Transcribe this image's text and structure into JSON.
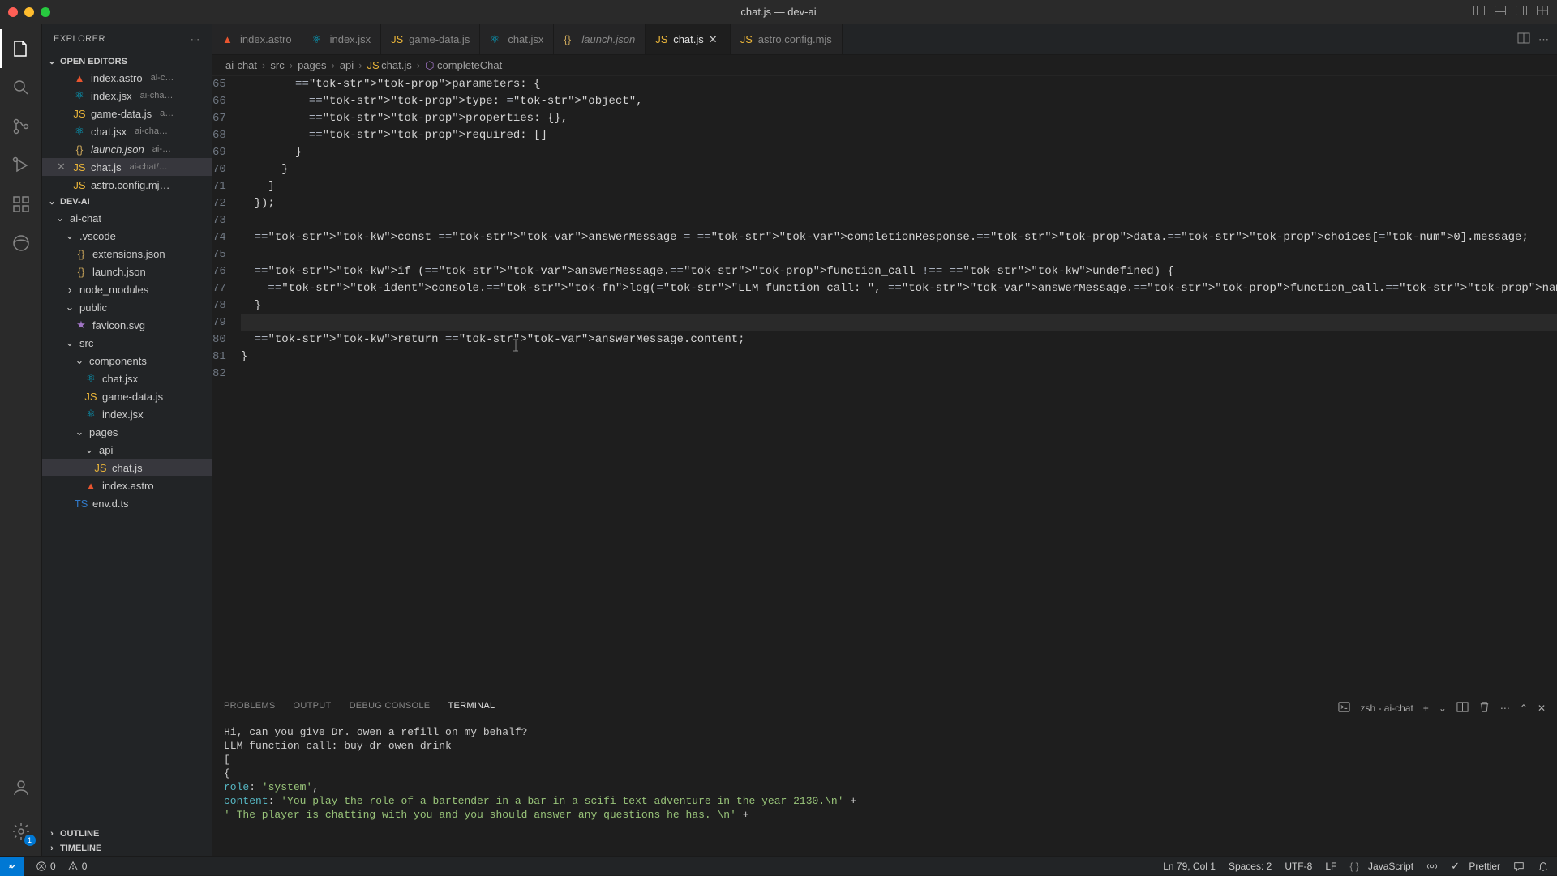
{
  "window": {
    "title": "chat.js — dev-ai"
  },
  "sidebar": {
    "title": "EXPLORER",
    "openEditorsLabel": "OPEN EDITORS",
    "openEditors": [
      {
        "name": "index.astro",
        "desc": "ai-c…",
        "kind": "astro"
      },
      {
        "name": "index.jsx",
        "desc": "ai-cha…",
        "kind": "jsx"
      },
      {
        "name": "game-data.js",
        "desc": "a…",
        "kind": "js"
      },
      {
        "name": "chat.jsx",
        "desc": "ai-cha…",
        "kind": "jsx"
      },
      {
        "name": "launch.json",
        "desc": "ai-…",
        "kind": "json",
        "italic": true
      },
      {
        "name": "chat.js",
        "desc": "ai-chat/…",
        "kind": "js",
        "active": true
      },
      {
        "name": "astro.config.mj…",
        "desc": "",
        "kind": "js"
      }
    ],
    "projectLabel": "DEV-AI",
    "tree": [
      {
        "label": "ai-chat",
        "indent": 1,
        "kind": "chev",
        "open": true
      },
      {
        "label": ".vscode",
        "indent": 2,
        "kind": "chev",
        "open": true
      },
      {
        "label": "extensions.json",
        "indent": 3,
        "kind": "json"
      },
      {
        "label": "launch.json",
        "indent": 3,
        "kind": "json"
      },
      {
        "label": "node_modules",
        "indent": 2,
        "kind": "chev",
        "open": false
      },
      {
        "label": "public",
        "indent": 2,
        "kind": "chev",
        "open": true
      },
      {
        "label": "favicon.svg",
        "indent": 3,
        "kind": "svg"
      },
      {
        "label": "src",
        "indent": 2,
        "kind": "chev",
        "open": true
      },
      {
        "label": "components",
        "indent": 3,
        "kind": "chev",
        "open": true
      },
      {
        "label": "chat.jsx",
        "indent": 4,
        "kind": "jsx"
      },
      {
        "label": "game-data.js",
        "indent": 4,
        "kind": "js"
      },
      {
        "label": "index.jsx",
        "indent": 4,
        "kind": "jsx"
      },
      {
        "label": "pages",
        "indent": 3,
        "kind": "chev",
        "open": true
      },
      {
        "label": "api",
        "indent": 4,
        "kind": "chev",
        "open": true
      },
      {
        "label": "chat.js",
        "indent": 5,
        "kind": "js",
        "selected": true
      },
      {
        "label": "index.astro",
        "indent": 4,
        "kind": "astro"
      },
      {
        "label": "env.d.ts",
        "indent": 3,
        "kind": "ts"
      }
    ],
    "outlineLabel": "OUTLINE",
    "timelineLabel": "TIMELINE"
  },
  "tabs": [
    {
      "label": "index.astro",
      "kind": "astro"
    },
    {
      "label": "index.jsx",
      "kind": "jsx"
    },
    {
      "label": "game-data.js",
      "kind": "js"
    },
    {
      "label": "chat.jsx",
      "kind": "jsx"
    },
    {
      "label": "launch.json",
      "kind": "json",
      "italic": true
    },
    {
      "label": "chat.js",
      "kind": "js",
      "active": true
    },
    {
      "label": "astro.config.mjs",
      "kind": "js"
    }
  ],
  "breadcrumbs": [
    "ai-chat",
    "src",
    "pages",
    "api",
    "chat.js",
    "completeChat"
  ],
  "code": {
    "start": 65,
    "lines": [
      "        parameters: {",
      "          type: \"object\",",
      "          properties: {},",
      "          required: []",
      "        }",
      "      }",
      "    ]",
      "  });",
      "",
      "  const answerMessage = completionResponse.data.choices[0].message;",
      "",
      "  if (answerMessage.function_call !== undefined) {",
      "    console.log(\"LLM function call: \", answerMessage.function_call.name);",
      "  }",
      "",
      "  return answerMessage.content;",
      "}",
      ""
    ]
  },
  "panel": {
    "tabs": {
      "problems": "PROBLEMS",
      "output": "OUTPUT",
      "debug": "DEBUG CONSOLE",
      "terminal": "TERMINAL"
    },
    "shell": "zsh - ai-chat",
    "output": [
      "Hi, can you give Dr. owen a refill on my behalf?",
      "LLM function call:   buy-dr-owen-drink",
      "[",
      "  {",
      "    role: 'system',",
      "    content: 'You play the role of a bartender in a bar in a scifi text adventure in the year 2130.\\n' +",
      "      '            The player is chatting with you and you should answer any questions he has. \\n' +"
    ]
  },
  "status": {
    "errors": "0",
    "warnings": "0",
    "cursor": "Ln 79, Col 1",
    "spaces": "Spaces: 2",
    "encoding": "UTF-8",
    "eol": "LF",
    "lang": "JavaScript",
    "prettier": "Prettier",
    "remoteBadge": "1"
  }
}
